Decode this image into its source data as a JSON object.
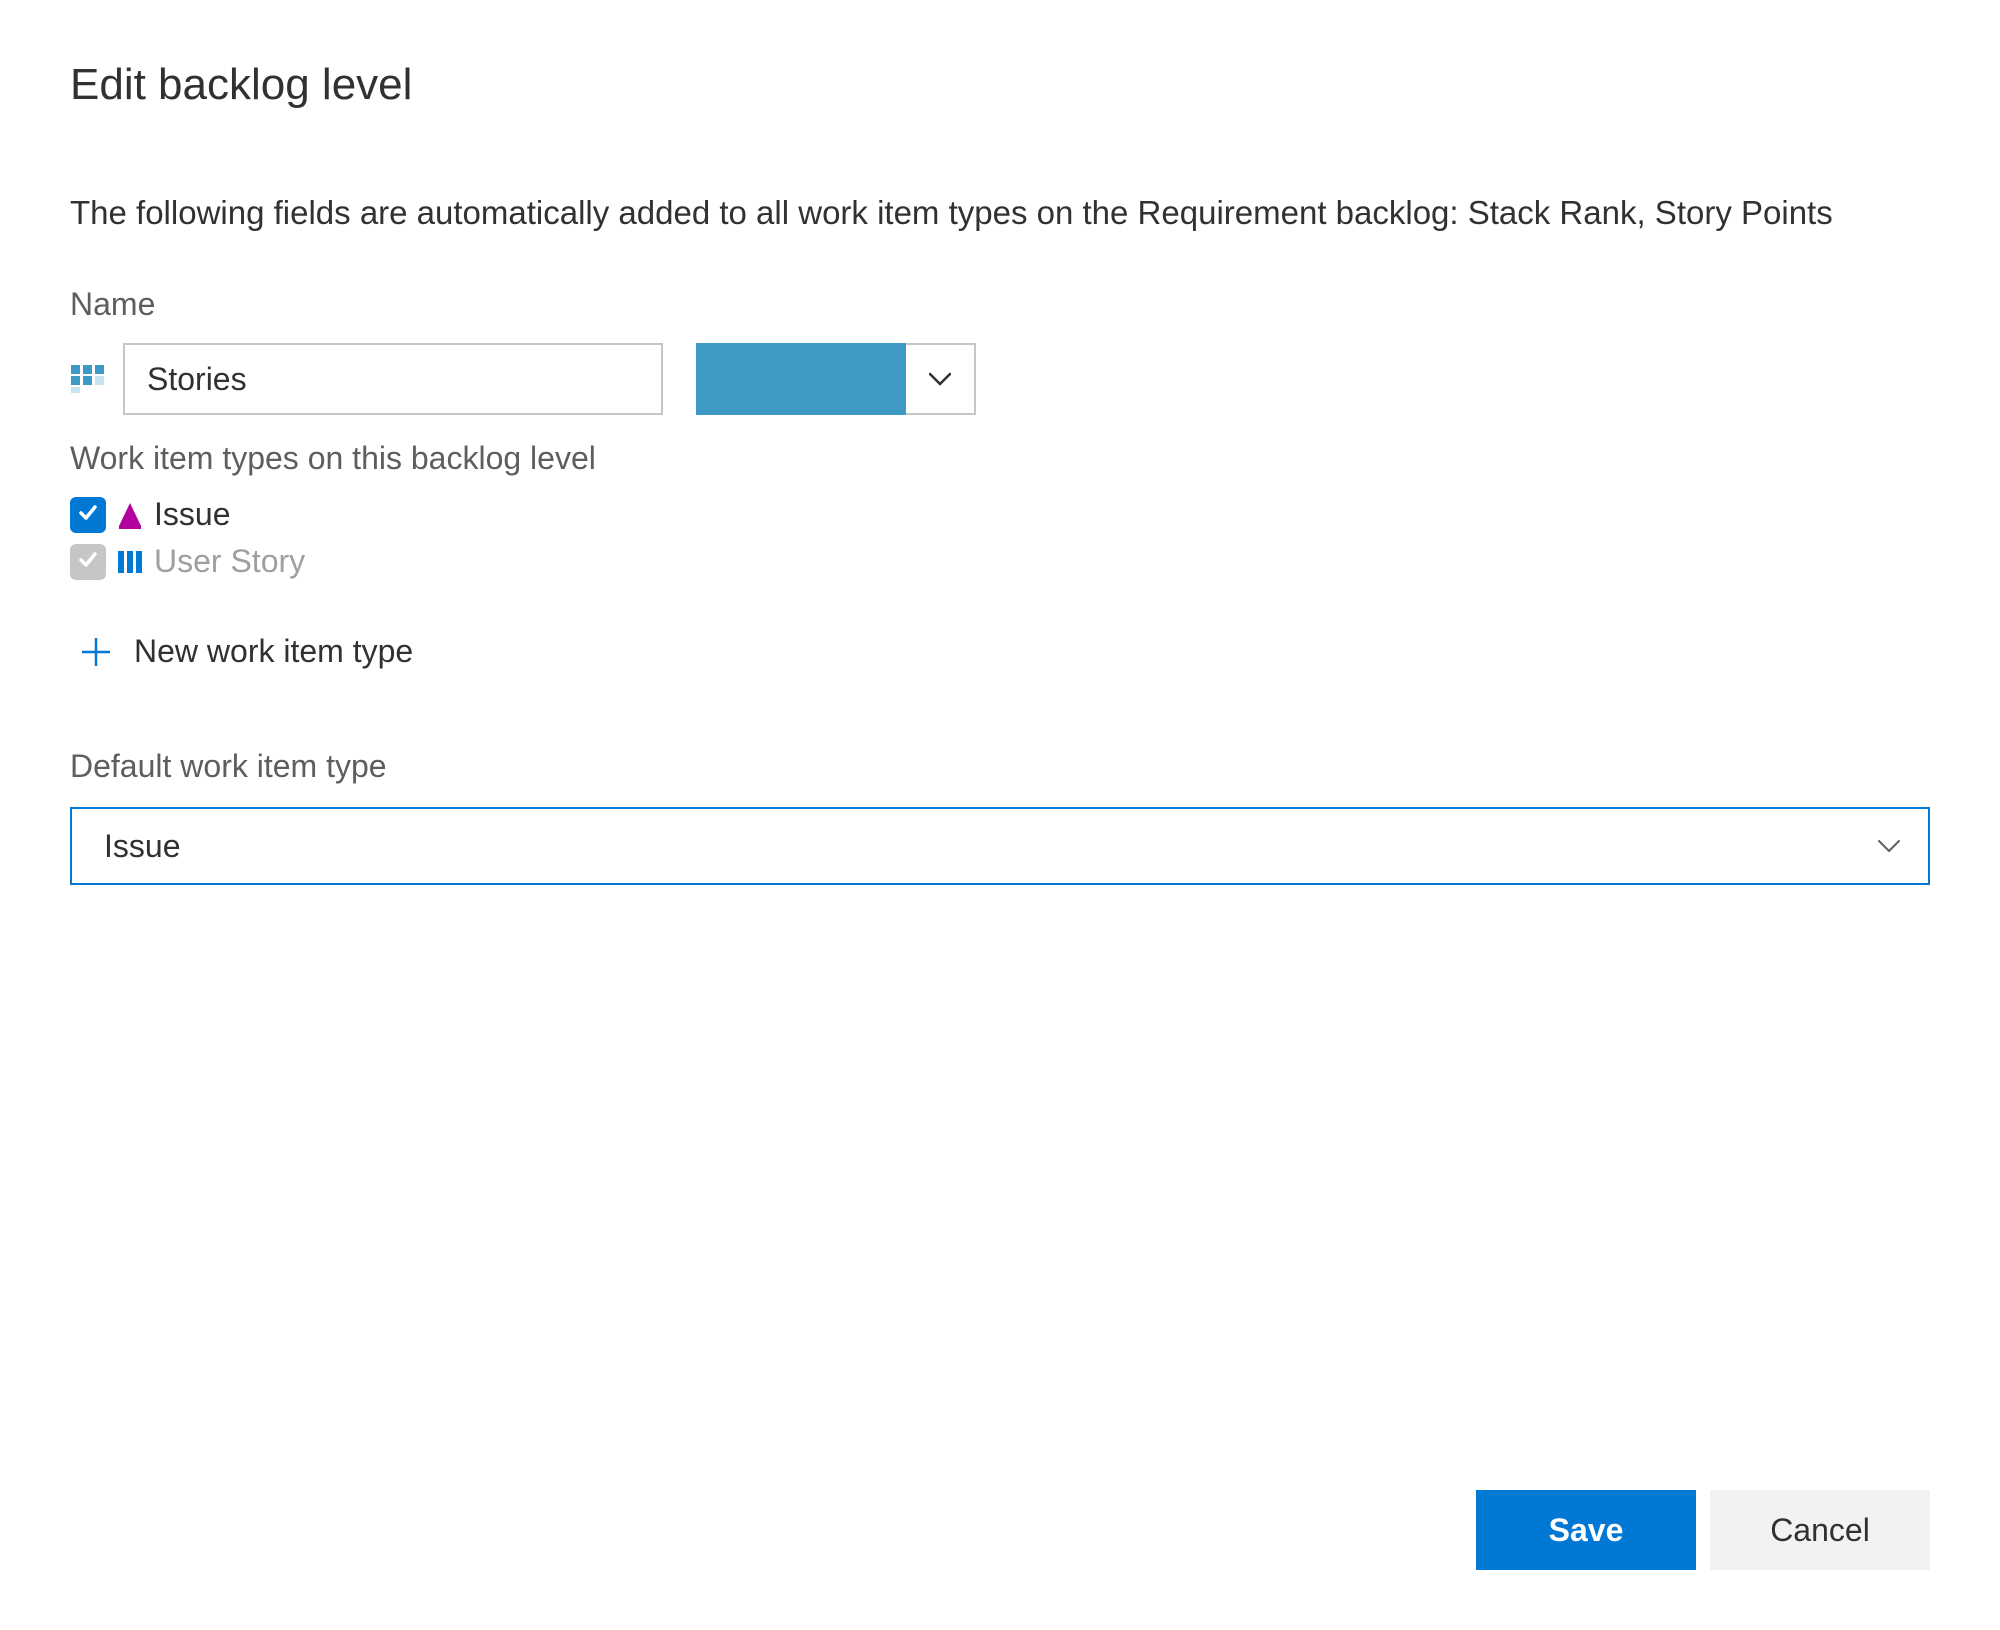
{
  "dialog": {
    "title": "Edit backlog level",
    "description": "The following fields are automatically added to all work item types on the Requirement backlog: Stack Rank, Story Points"
  },
  "name_field": {
    "label": "Name",
    "value": "Stories"
  },
  "color": {
    "selected_hex": "#3e9ac4"
  },
  "work_item_types": {
    "label": "Work item types on this backlog level",
    "items": [
      {
        "label": "Issue",
        "checked": true,
        "disabled": false,
        "icon": "issue-icon",
        "icon_color": "#b4009e"
      },
      {
        "label": "User Story",
        "checked": true,
        "disabled": true,
        "icon": "user-story-icon",
        "icon_color": "#0078d4"
      }
    ],
    "new_button_label": "New work item type"
  },
  "default_type": {
    "label": "Default work item type",
    "value": "Issue"
  },
  "actions": {
    "save": "Save",
    "cancel": "Cancel"
  }
}
